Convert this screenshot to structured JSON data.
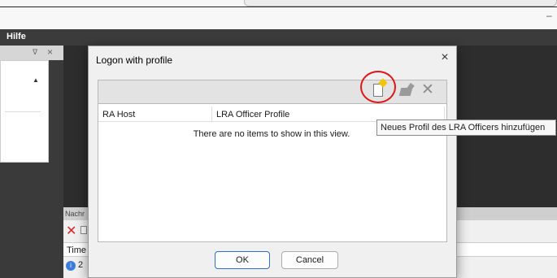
{
  "menu": {
    "hilfe": "Hilfe"
  },
  "left_panel": {
    "pin": "14",
    "close": "×",
    "scroll_up": "▲"
  },
  "bottom_panel": {
    "title": "Nachr",
    "column_time": "Time",
    "row_value": "2"
  },
  "dialog": {
    "title": "Logon with profile",
    "close": "×",
    "columns": [
      "RA Host",
      "LRA Officer Profile"
    ],
    "empty_message": "There are no items to show in this view.",
    "ok_label": "OK",
    "cancel_label": "Cancel",
    "delete_glyph": "✕"
  },
  "tooltip": {
    "text": "Neues Profil des LRA Officers hinzufügen"
  },
  "colors": {
    "accent": "#2f6fd1",
    "highlight": "#e01515",
    "menubar": "#3b3b3b"
  }
}
